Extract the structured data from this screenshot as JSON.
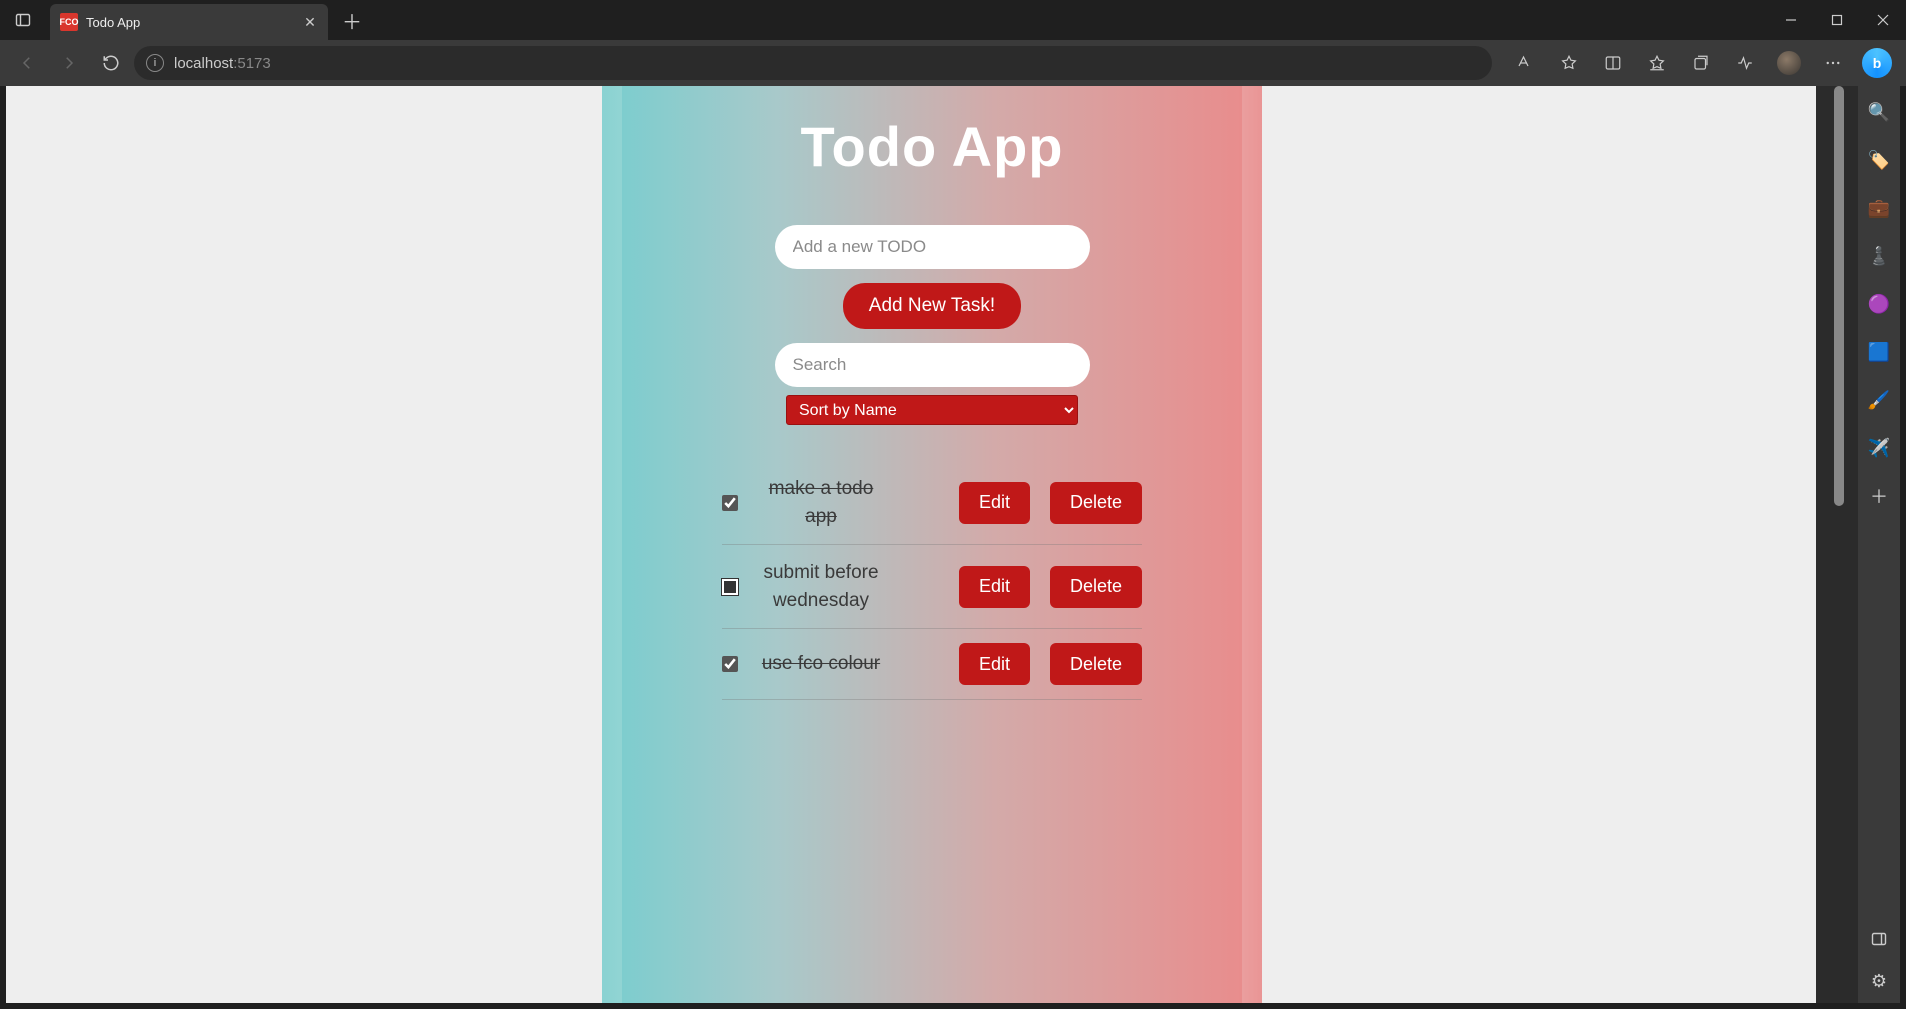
{
  "browser": {
    "tab_title": "Todo App",
    "tab_favicon_text": "FCO",
    "url_host": "localhost",
    "url_port": ":5173"
  },
  "app": {
    "title": "Todo App",
    "add_input_placeholder": "Add a new TODO",
    "add_input_value": "",
    "add_button_label": "Add New Task!",
    "search_placeholder": "Search",
    "search_value": "",
    "sort_selected": "Sort by Name",
    "edit_label": "Edit",
    "delete_label": "Delete",
    "todos": [
      {
        "text": "make a todo app",
        "done": true,
        "indeterminate": false
      },
      {
        "text": "submit before wednesday",
        "done": false,
        "indeterminate": true
      },
      {
        "text": "use fco colour",
        "done": true,
        "indeterminate": false
      }
    ]
  }
}
